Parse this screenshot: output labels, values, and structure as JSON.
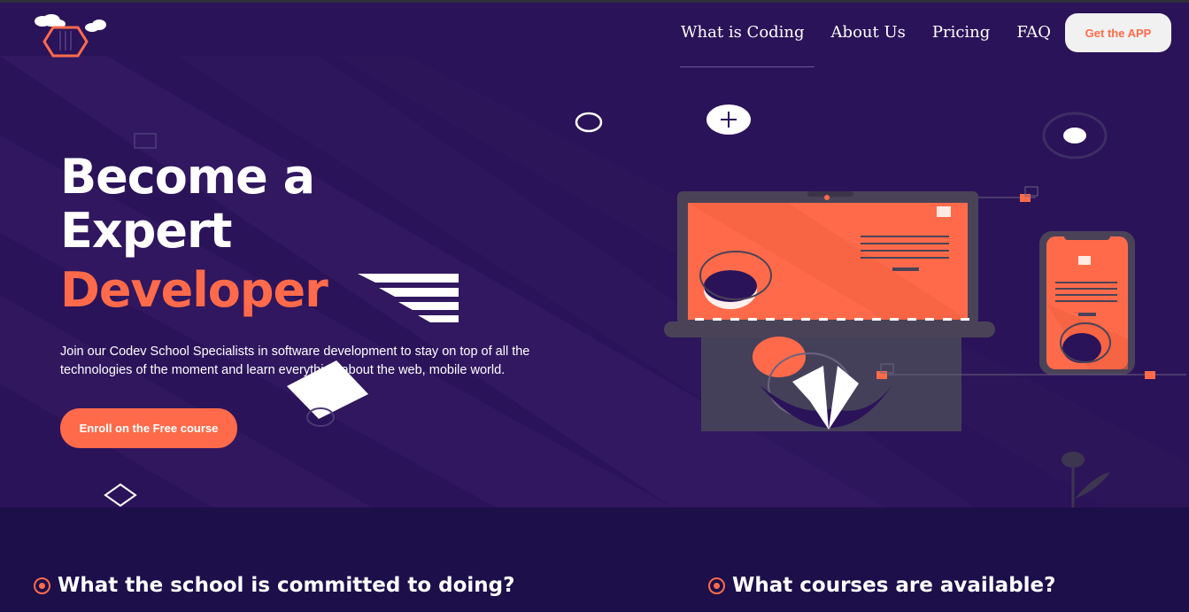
{
  "nav": {
    "items": [
      "What is Coding",
      "About Us",
      "Pricing",
      "FAQ"
    ],
    "cta": "Get the APP"
  },
  "hero": {
    "title_line1": "Become a",
    "title_line2": "Expert",
    "title_accent": "Developer",
    "description": "Join our Codev School Specialists in software development to stay on top of all the technologies of the moment and learn everything about the web, mobile world.",
    "cta": "Enroll on the Free course"
  },
  "sections": {
    "left_heading": "What the school is committed to doing?",
    "right_heading": "What courses are available?"
  },
  "colors": {
    "accent": "#ff6b4a",
    "hero_bg": "#2b1359",
    "page_bg": "#1c0f4a"
  }
}
